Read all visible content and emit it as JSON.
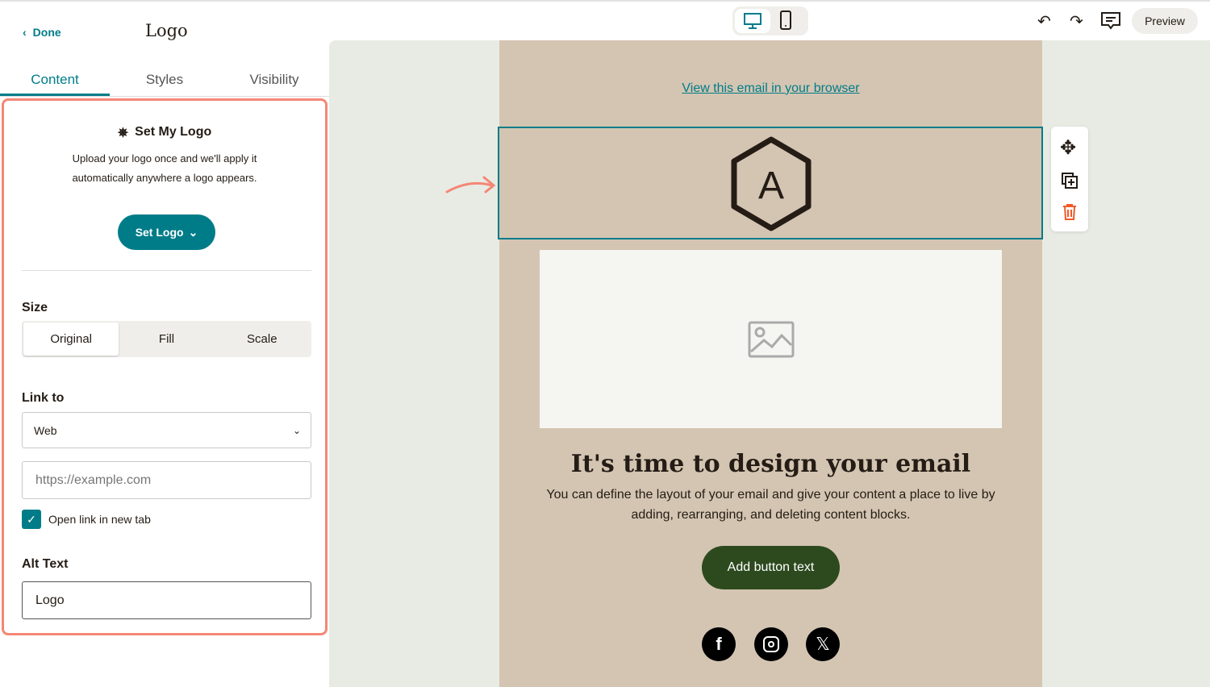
{
  "sidebar": {
    "done_label": "Done",
    "title": "Logo",
    "tabs": [
      {
        "label": "Content"
      },
      {
        "label": "Styles"
      },
      {
        "label": "Visibility"
      }
    ],
    "set_logo": {
      "heading": "Set My Logo",
      "desc1": "Upload your logo once and we'll apply it",
      "desc2": "automatically anywhere a logo appears.",
      "button": "Set Logo"
    },
    "size": {
      "label": "Size",
      "options": [
        "Original",
        "Fill",
        "Scale"
      ],
      "selected": "Original"
    },
    "link": {
      "label": "Link to",
      "type": "Web",
      "url_placeholder": "https://example.com",
      "url_value": "",
      "new_tab_label": "Open link in new tab",
      "new_tab_checked": true
    },
    "alt": {
      "label": "Alt Text",
      "value": "Logo"
    }
  },
  "toolbar": {
    "preview_label": "Preview",
    "view_mode": "desktop"
  },
  "email": {
    "browser_link": "View this email in your browser",
    "logo_letter": "A",
    "heading": "It's time to design your email",
    "body1": "You can define the layout of your email and give your content a place to live by",
    "body2": "adding, rearranging, and deleting content blocks.",
    "button": "Add button text",
    "social": [
      "facebook-icon",
      "instagram-icon",
      "x-icon"
    ]
  },
  "colors": {
    "accent": "#007c89",
    "highlight": "#f48776",
    "email_bg": "#d4c5b2",
    "cta": "#2d4a1e",
    "delete": "#f05a28"
  }
}
